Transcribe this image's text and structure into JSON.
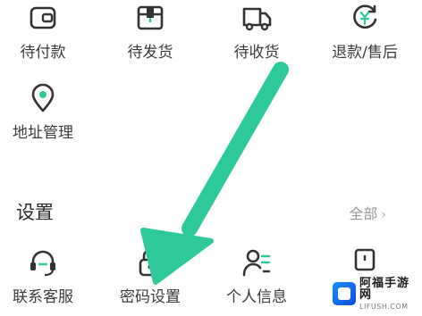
{
  "orders": {
    "items": [
      {
        "label": "待付款",
        "icon": "wallet-icon"
      },
      {
        "label": "待发货",
        "icon": "package-icon"
      },
      {
        "label": "待收货",
        "icon": "truck-icon"
      },
      {
        "label": "退款/售后",
        "icon": "refund-icon"
      }
    ]
  },
  "address": {
    "label": "地址管理",
    "icon": "location-pin-icon"
  },
  "settings": {
    "title": "设置",
    "see_all": "全部",
    "items": [
      {
        "label": "联系客服",
        "icon": "headset-icon"
      },
      {
        "label": "密码设置",
        "icon": "lock-icon"
      },
      {
        "label": "个人信息",
        "icon": "user-list-icon"
      }
    ]
  },
  "overlay": {
    "arrow_color": "#2ec99a"
  },
  "watermark": {
    "name": "阿福手游网",
    "url": "LIFUSH.COM"
  },
  "colors": {
    "icon_stroke": "#333333",
    "label": "#3a3a3a",
    "muted": "#9a9a9a"
  }
}
